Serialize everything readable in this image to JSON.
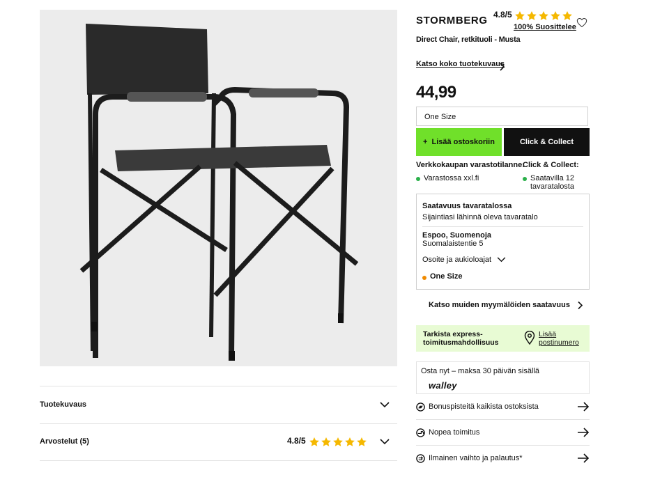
{
  "product": {
    "brand": "STORMBERG",
    "rating": "4.8/5",
    "rating_value": 4.8,
    "recommend": "100% Suosittelee",
    "name": "Direct Chair, retkituoli - Musta",
    "see_description": "Katso koko tuotekuvaus",
    "price": "44,99",
    "size_value": "One Size"
  },
  "actions": {
    "add_to_cart_icon": "+",
    "add_to_cart": "Lisää ostoskoriin",
    "click_collect": "Click & Collect"
  },
  "stock": {
    "online_heading": "Verkkokaupan varastotilanne:",
    "online_status": "Varastossa xxl.fi",
    "cc_heading": "Click & Collect:",
    "cc_status": "Saatavilla 12 tavaratalosta"
  },
  "store": {
    "heading": "Saatavuus tavaratalossa",
    "subheading": "Sijaintiasi lähinnä oleva tavaratalo",
    "name": "Espoo, Suomenoja",
    "address": "Suomalaistentie 5",
    "hours_toggle": "Osoite ja aukioloajat",
    "size": "One Size",
    "other_stores": "Katso muiden myymälöiden saatavuus"
  },
  "express": {
    "label": "Tarkista express-toimitusmahdollisuus",
    "link": "Lisää postinumero"
  },
  "walley": {
    "text": "Osta nyt – maksa 30 päivän sisällä",
    "logo": "walley"
  },
  "usps": [
    {
      "label": "Bonuspisteitä kaikista ostoksista",
      "icon": "bonus-icon"
    },
    {
      "label": "Nopea toimitus",
      "icon": "delivery-icon"
    },
    {
      "label": "Ilmainen vaihto ja palautus*",
      "icon": "return-icon"
    }
  ],
  "accordion": {
    "description": "Tuotekuvaus",
    "reviews": "Arvostelut (5)",
    "reviews_rating": "4.8/5"
  },
  "colors": {
    "accent_green": "#70e02a",
    "star": "#f5b800",
    "stock_green": "#2bb04a",
    "size_orange": "#f08a00",
    "express_bg": "#e8fbd4"
  }
}
